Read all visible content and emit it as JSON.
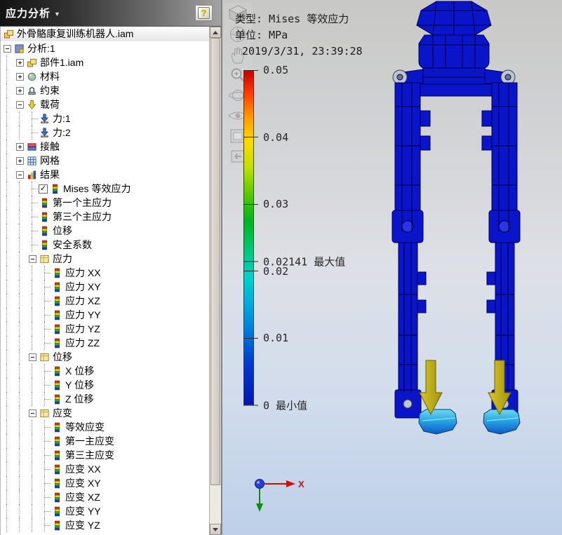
{
  "panel": {
    "title": "应力分析",
    "dropdown": "▼",
    "help": "?"
  },
  "browser": {
    "root": {
      "label": "外骨骼康复训练机器人.iam",
      "icon": "assembly"
    },
    "tree": [
      {
        "label": "分析:1",
        "icon": "analysis",
        "level": 0,
        "expand": "minus"
      },
      {
        "label": "部件1.iam",
        "icon": "assembly",
        "level": 1,
        "expand": "plus"
      },
      {
        "label": "材料",
        "icon": "material",
        "level": 1,
        "expand": "plus"
      },
      {
        "label": "约束",
        "icon": "constraint",
        "level": 1,
        "expand": "plus"
      },
      {
        "label": "载荷",
        "icon": "load",
        "level": 1,
        "expand": "minus"
      },
      {
        "label": "力:1",
        "icon": "force",
        "level": 2
      },
      {
        "label": "力:2",
        "icon": "force",
        "level": 2
      },
      {
        "label": "接触",
        "icon": "contact",
        "level": 1,
        "expand": "plus"
      },
      {
        "label": "网格",
        "icon": "mesh",
        "level": 1,
        "expand": "plus"
      },
      {
        "label": "结果",
        "icon": "results",
        "level": 1,
        "expand": "minus"
      },
      {
        "label": "Mises 等效应力",
        "icon": "result",
        "level": 2,
        "checked": true
      },
      {
        "label": "第一个主应力",
        "icon": "result",
        "level": 2
      },
      {
        "label": "第三个主应力",
        "icon": "result",
        "level": 2
      },
      {
        "label": "位移",
        "icon": "result",
        "level": 2
      },
      {
        "label": "安全系数",
        "icon": "result",
        "level": 2
      },
      {
        "label": "应力",
        "icon": "folder",
        "level": 2,
        "expand": "minus"
      },
      {
        "label": "应力 XX",
        "icon": "result",
        "level": 3
      },
      {
        "label": "应力 XY",
        "icon": "result",
        "level": 3
      },
      {
        "label": "应力 XZ",
        "icon": "result",
        "level": 3
      },
      {
        "label": "应力 YY",
        "icon": "result",
        "level": 3
      },
      {
        "label": "应力 YZ",
        "icon": "result",
        "level": 3
      },
      {
        "label": "应力 ZZ",
        "icon": "result",
        "level": 3
      },
      {
        "label": "位移",
        "icon": "folder",
        "level": 2,
        "expand": "minus"
      },
      {
        "label": "X 位移",
        "icon": "result",
        "level": 3
      },
      {
        "label": "Y 位移",
        "icon": "result",
        "level": 3
      },
      {
        "label": "Z 位移",
        "icon": "result",
        "level": 3
      },
      {
        "label": "应变",
        "icon": "folder",
        "level": 2,
        "expand": "minus"
      },
      {
        "label": "等效应变",
        "icon": "result",
        "level": 3
      },
      {
        "label": "第一主应变",
        "icon": "result",
        "level": 3
      },
      {
        "label": "第三主应变",
        "icon": "result",
        "level": 3
      },
      {
        "label": "应变 XX",
        "icon": "result",
        "level": 3
      },
      {
        "label": "应变 XY",
        "icon": "result",
        "level": 3
      },
      {
        "label": "应变 XZ",
        "icon": "result",
        "level": 3
      },
      {
        "label": "应变 YY",
        "icon": "result",
        "level": 3
      },
      {
        "label": "应变 YZ",
        "icon": "result",
        "level": 3
      }
    ]
  },
  "viewport": {
    "annotations": {
      "type_label": "类型: Mises 等效应力",
      "unit_label": "单位: MPa",
      "timestamp": "2019/3/31, 23:39:28"
    },
    "legend": {
      "unit": "MPa",
      "max_value": "0.02141",
      "min_value": "0",
      "colors": [
        "#c80000 0%",
        "#ff4000 7%",
        "#ff9c00 14%",
        "#ffd800 21%",
        "#bfe000 29%",
        "#59c800 37%",
        "#00b41e 45%",
        "#00c87d 54%",
        "#00d2c8 62%",
        "#00aadc 70%",
        "#0073d8 79%",
        "#0039cc 88%",
        "#0016b0 100%"
      ],
      "ticks": [
        {
          "label": "0.05",
          "frac": 0.0
        },
        {
          "label": "0.04",
          "frac": 0.2
        },
        {
          "label": "0.03",
          "frac": 0.4
        },
        {
          "label": "0.02141 最大值",
          "frac": 0.5718
        },
        {
          "label": "0.02",
          "frac": 0.6
        },
        {
          "label": "0.01",
          "frac": 0.8
        },
        {
          "label": "0 最小值",
          "frac": 1.0
        }
      ]
    },
    "nav_tools": [
      {
        "name": "view-cube-icon"
      },
      {
        "name": "navigation-wheel-icon"
      },
      {
        "name": "pan-hand-icon"
      },
      {
        "name": "zoom-icon"
      },
      {
        "name": "orbit-icon"
      },
      {
        "name": "look-at-icon"
      },
      {
        "name": "view-face-icon"
      },
      {
        "name": "previous-view-icon"
      }
    ],
    "triad": {
      "x_label": "X"
    }
  }
}
